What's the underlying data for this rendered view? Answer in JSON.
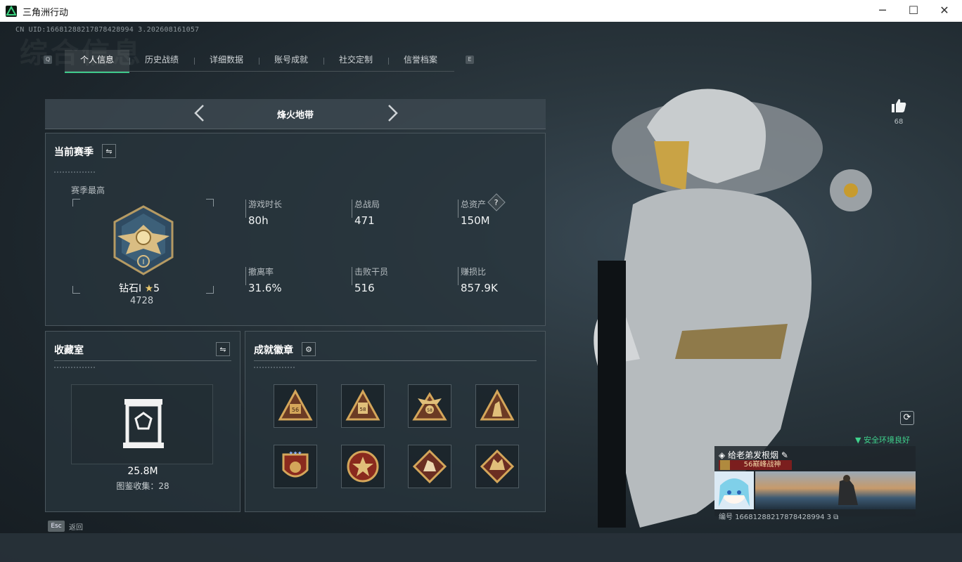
{
  "window": {
    "title": "三角洲行动",
    "min_icon": "minimize-icon",
    "max_icon": "maximize-icon",
    "close_icon": "close-icon"
  },
  "header": {
    "uid": "CN UID:16681288217878428994 3.202608161057",
    "bg_title": "综合信息"
  },
  "tabs": {
    "left_key": "Q",
    "right_key": "E",
    "items": [
      {
        "label": "个人信息",
        "active": true
      },
      {
        "label": "历史战绩"
      },
      {
        "label": "详细数据"
      },
      {
        "label": "账号成就"
      },
      {
        "label": "社交定制"
      },
      {
        "label": "信誉档案"
      }
    ]
  },
  "mode": {
    "label": "烽火地带",
    "prev_icon": "chevron-left-icon",
    "next_icon": "chevron-right-icon"
  },
  "season": {
    "title": "当前赛季",
    "best_label": "赛季最高",
    "rank_name": "钻石I",
    "rank_stars": "5",
    "rank_points": "4728",
    "stats": [
      {
        "label": "游戏时长",
        "value": "80h"
      },
      {
        "label": "总战局",
        "value": "471"
      },
      {
        "label": "总资产",
        "value": "150M",
        "help": "?"
      },
      {
        "label": "撤离率",
        "value": "31.6%"
      },
      {
        "label": "击败干员",
        "value": "516"
      },
      {
        "label": "赚损比",
        "value": "857.9K"
      }
    ]
  },
  "collection": {
    "title": "收藏室",
    "value": "25.8M",
    "catalog_label": "图鉴收集：",
    "catalog_count": "28"
  },
  "achievements": {
    "title": "成就徽章",
    "badges": [
      {
        "name": "badge-triangle-56-a",
        "text": "56"
      },
      {
        "name": "badge-triangle-58",
        "text": "58"
      },
      {
        "name": "badge-triangle-winged",
        "text": "58"
      },
      {
        "name": "badge-triangle-soldier",
        "text": ""
      },
      {
        "name": "badge-shield-stars",
        "text": ""
      },
      {
        "name": "badge-round-star",
        "text": ""
      },
      {
        "name": "badge-diamond-wolf",
        "text": ""
      },
      {
        "name": "badge-diamond-dragon",
        "text": ""
      }
    ]
  },
  "profile": {
    "likes": "68",
    "safe_env": "安全环境良好",
    "player_name": "给老弟发根烟",
    "title_badge": "56巅峰战神",
    "id_label": "编号",
    "id_value": "16681288217878428994 3"
  },
  "footer": {
    "esc_key": "Esc",
    "back_label": "返回"
  },
  "colors": {
    "accent_green": "#3fc98a",
    "gold": "#c9a35a",
    "title_red": "#8a1d1d"
  }
}
